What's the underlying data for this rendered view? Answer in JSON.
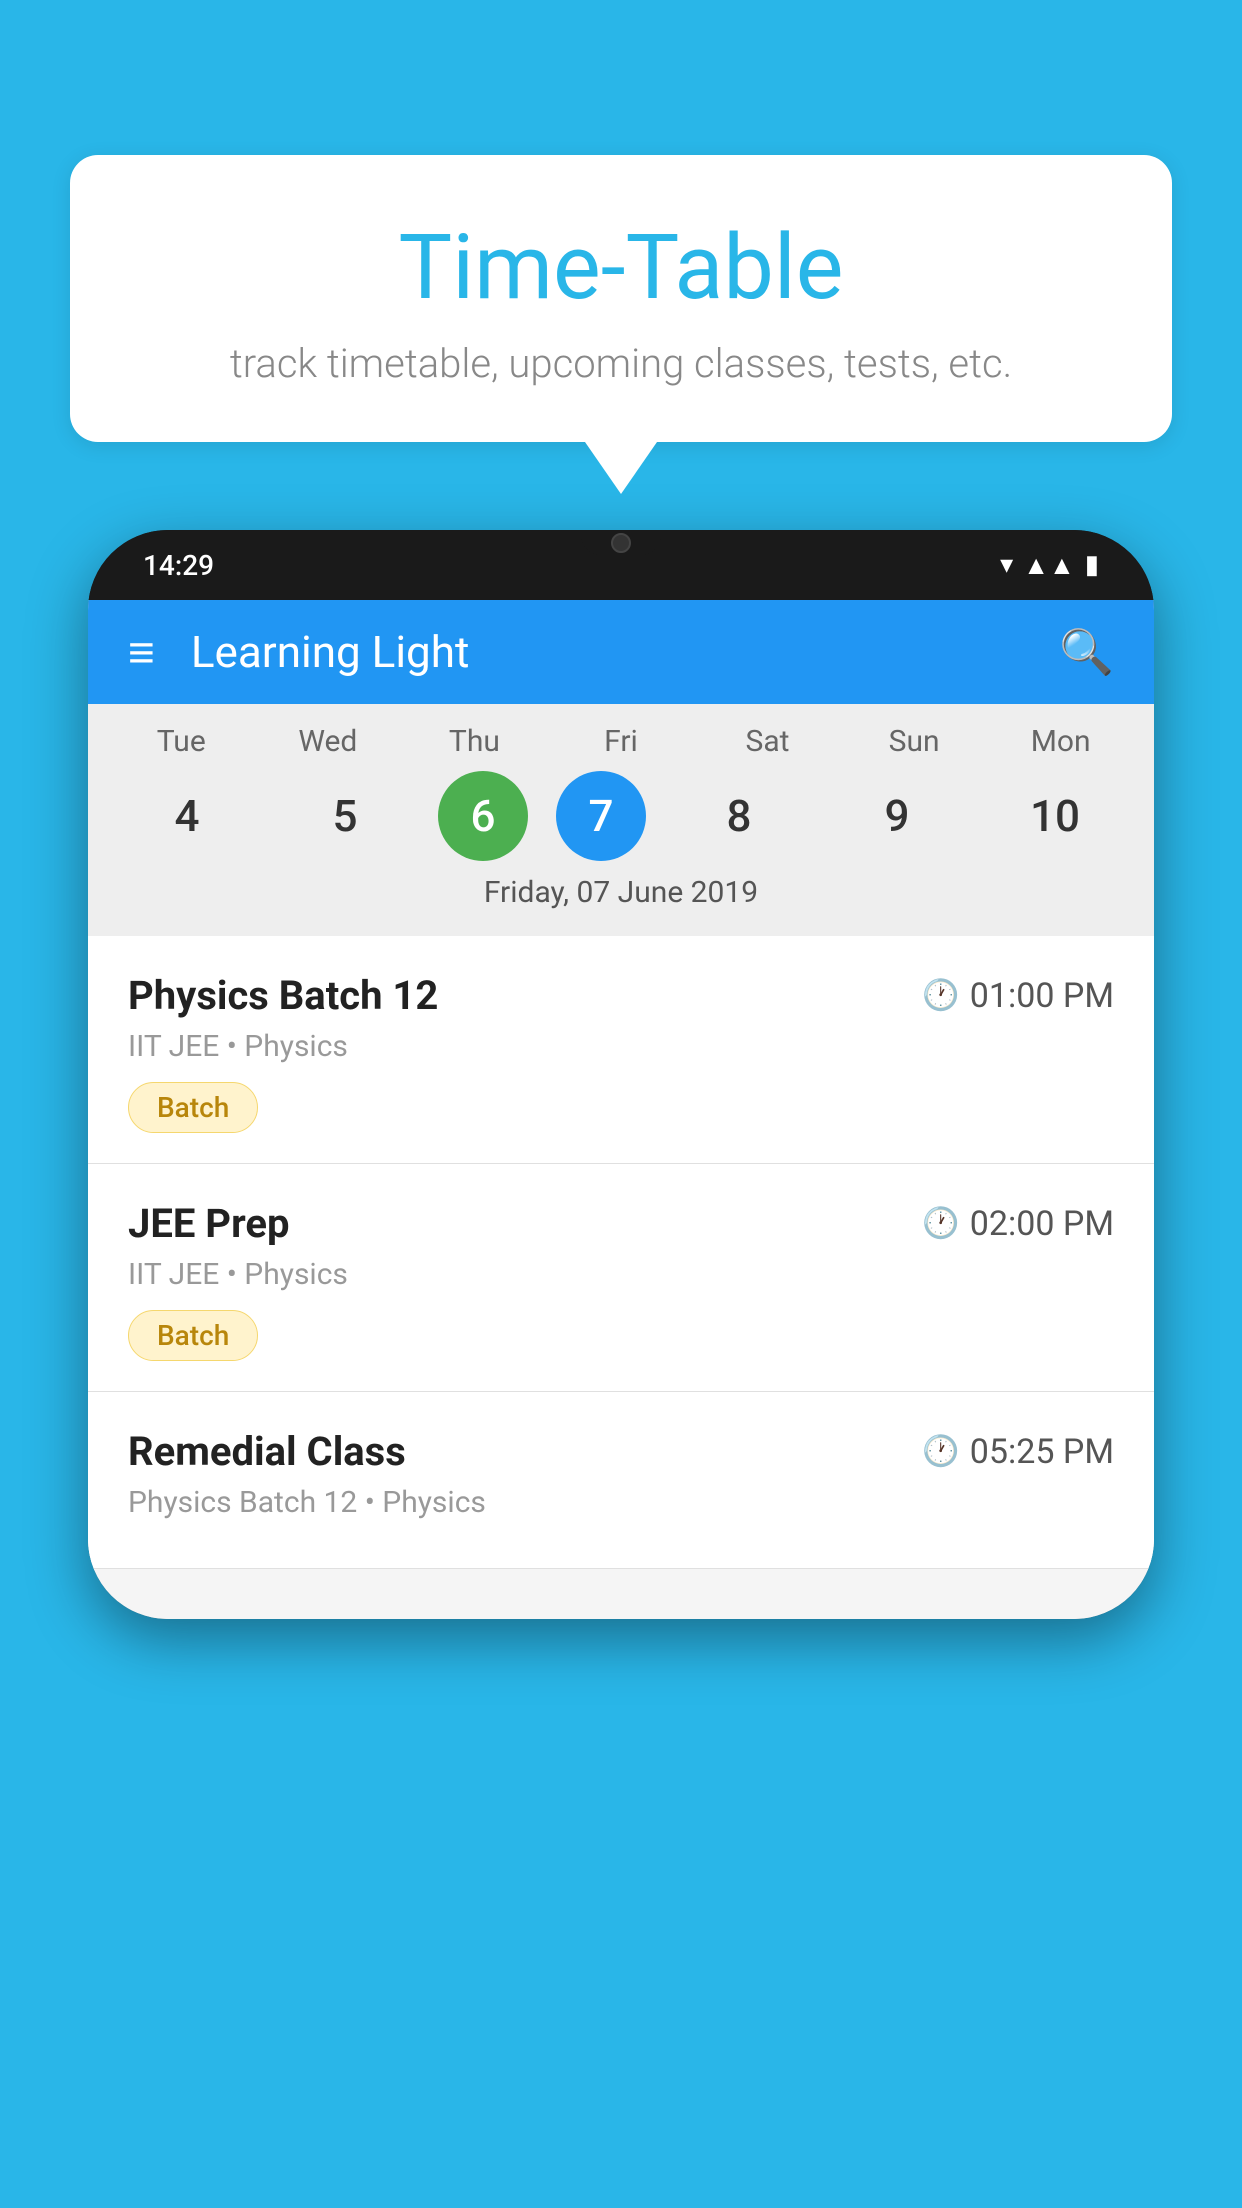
{
  "background_color": "#29B6E8",
  "speech_bubble": {
    "title": "Time-Table",
    "subtitle": "track timetable, upcoming classes, tests, etc."
  },
  "phone": {
    "status_bar": {
      "time": "14:29"
    },
    "app_bar": {
      "title": "Learning Light"
    },
    "calendar": {
      "days": [
        {
          "short": "Tue",
          "number": "4"
        },
        {
          "short": "Wed",
          "number": "5"
        },
        {
          "short": "Thu",
          "number": "6",
          "state": "today"
        },
        {
          "short": "Fri",
          "number": "7",
          "state": "selected"
        },
        {
          "short": "Sat",
          "number": "8"
        },
        {
          "short": "Sun",
          "number": "9"
        },
        {
          "short": "Mon",
          "number": "10"
        }
      ],
      "selected_date_label": "Friday, 07 June 2019"
    },
    "schedule": [
      {
        "title": "Physics Batch 12",
        "time": "01:00 PM",
        "subtitle": "IIT JEE • Physics",
        "tag": "Batch"
      },
      {
        "title": "JEE Prep",
        "time": "02:00 PM",
        "subtitle": "IIT JEE • Physics",
        "tag": "Batch"
      },
      {
        "title": "Remedial Class",
        "time": "05:25 PM",
        "subtitle": "Physics Batch 12 • Physics",
        "tag": null
      }
    ]
  },
  "icons": {
    "hamburger": "≡",
    "search": "🔍",
    "clock": "🕐"
  }
}
